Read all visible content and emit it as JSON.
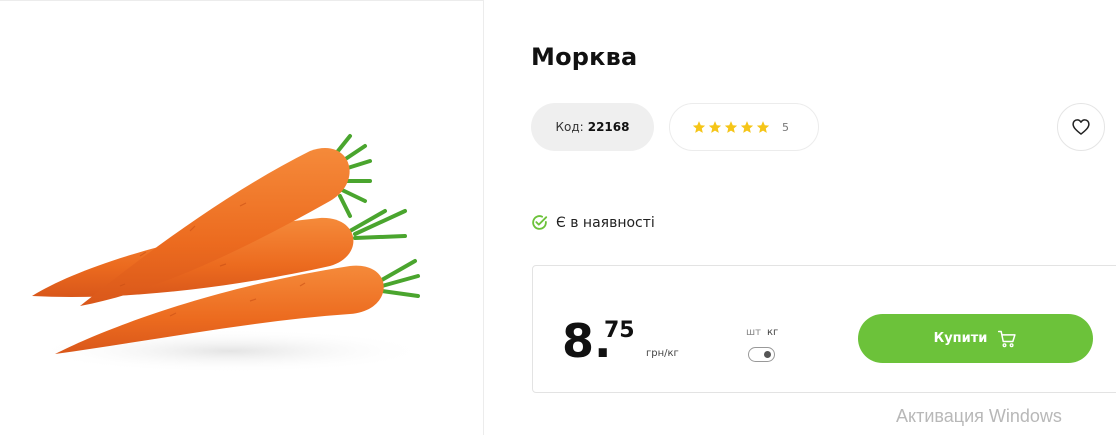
{
  "product": {
    "title": "Морква",
    "code_label": "Код:",
    "code_value": "22168",
    "rating_count": "5",
    "stars": 5,
    "stock_text": "Є в наявності"
  },
  "price": {
    "whole": "8.",
    "cents": "75",
    "unit": "грн/кг"
  },
  "unit_toggle": {
    "option_pcs": "шт",
    "option_kg": "кг",
    "selected": "кг"
  },
  "buy_button": {
    "label": "Купити"
  },
  "watermark": {
    "text": "Активация Windows"
  },
  "colors": {
    "accent_green": "#6cc23a",
    "star_yellow": "#f5c518",
    "stock_green": "#6cc23a"
  },
  "icons": {
    "favorite": "heart-icon",
    "cart": "cart-icon",
    "stock": "check-circle-icon",
    "rating": "star-icon"
  }
}
